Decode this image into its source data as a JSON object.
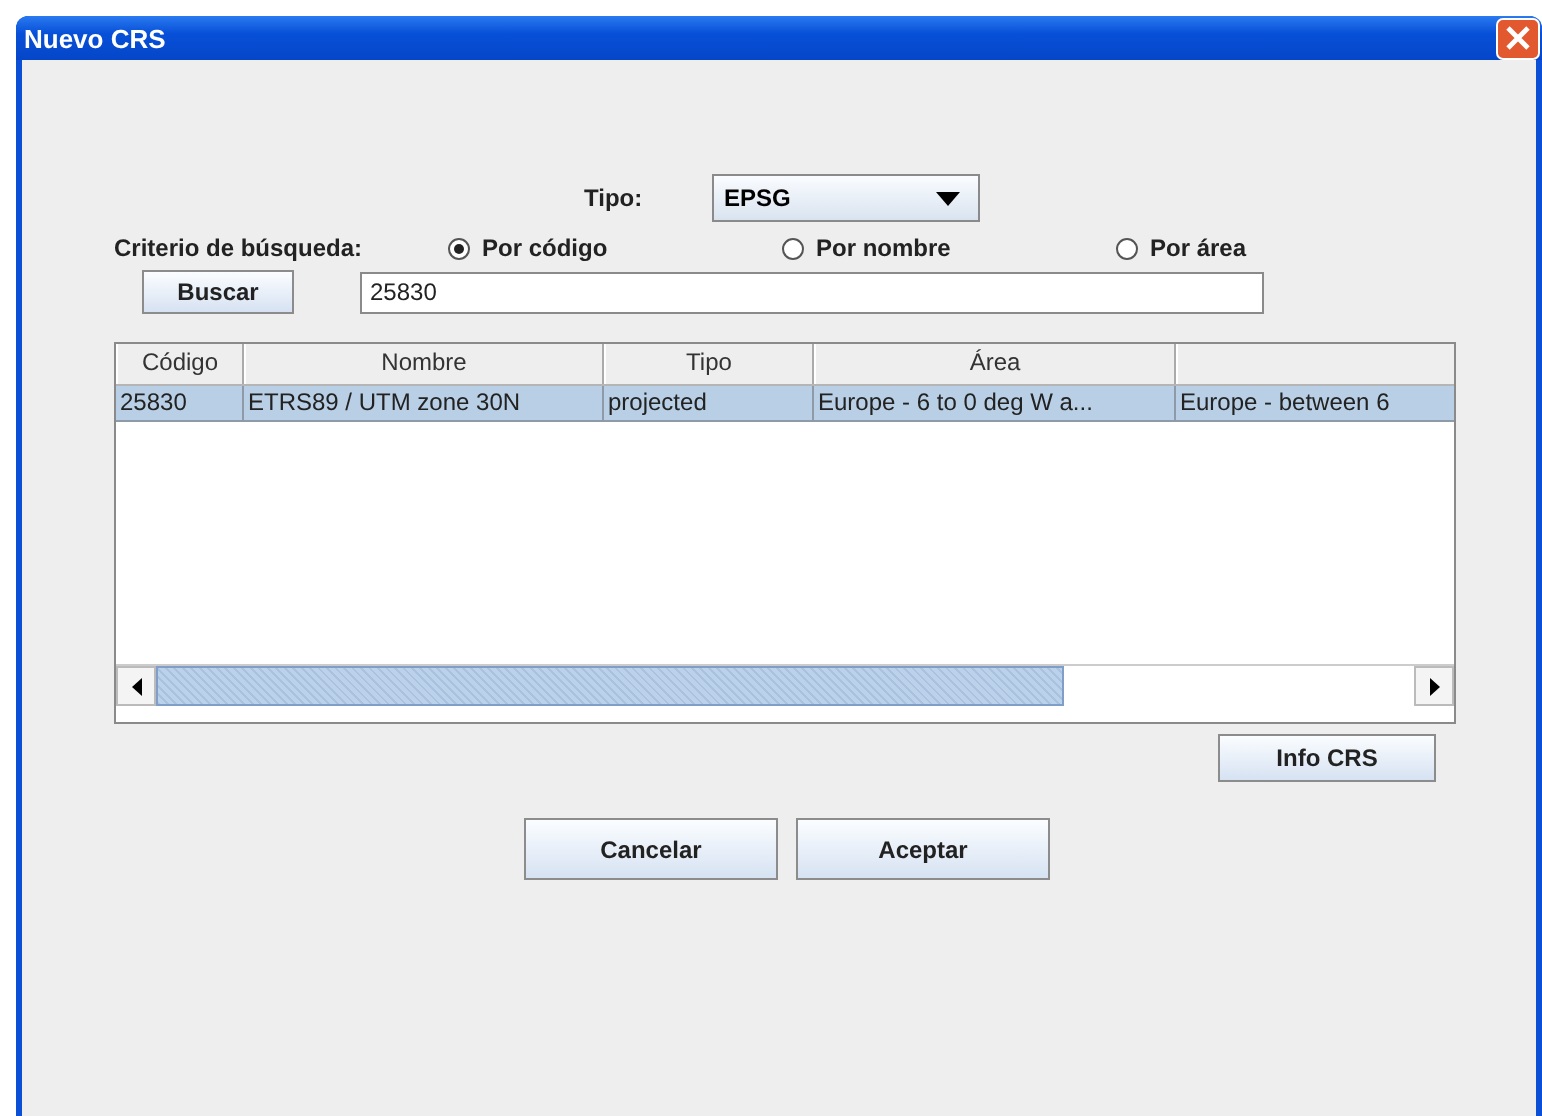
{
  "window": {
    "title": "Nuevo CRS"
  },
  "tipo": {
    "label": "Tipo:",
    "value": "EPSG"
  },
  "criterio": {
    "label": "Criterio de búsqueda:",
    "options": [
      {
        "label": "Por código",
        "selected": true
      },
      {
        "label": "Por nombre",
        "selected": false
      },
      {
        "label": "Por área",
        "selected": false
      }
    ]
  },
  "search": {
    "button": {
      "label": "Buscar"
    },
    "value": "25830"
  },
  "table": {
    "columns": [
      "Código",
      "Nombre",
      "Tipo",
      "Área"
    ],
    "rows": [
      {
        "selected": true,
        "cells": [
          "25830",
          "ETRS89 / UTM zone 30N",
          "projected",
          "Europe - 6 to 0 deg W a...",
          "Europe - between 6"
        ]
      }
    ]
  },
  "info_button": {
    "label": "Info CRS"
  },
  "buttons": [
    {
      "label": "Cancelar"
    },
    {
      "label": "Aceptar"
    }
  ]
}
